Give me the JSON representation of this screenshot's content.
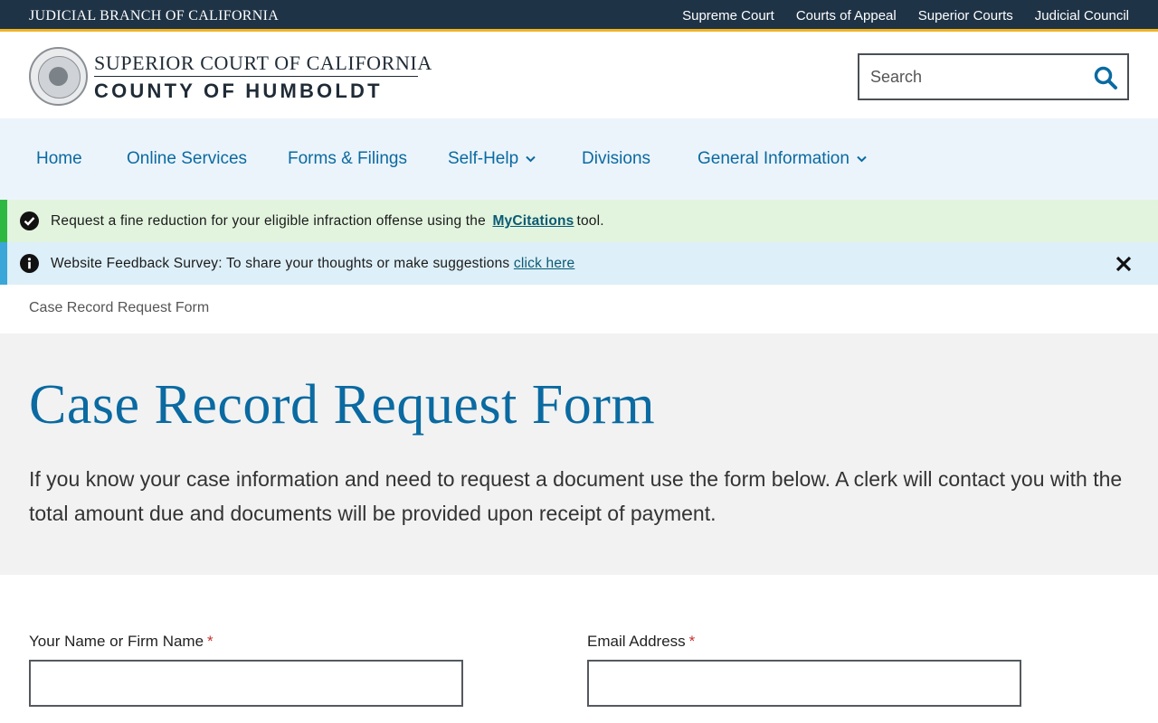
{
  "topbar": {
    "branch_label": "JUDICIAL BRANCH OF CALIFORNIA",
    "links": [
      "Supreme Court",
      "Courts of Appeal",
      "Superior Courts",
      "Judicial Council"
    ]
  },
  "header": {
    "brand_line1": "SUPERIOR COURT OF CALIFORNIA",
    "brand_line2": "COUNTY OF HUMBOLDT",
    "search_placeholder": "Search",
    "search_icon": "magnifier-icon"
  },
  "nav": {
    "items": [
      {
        "label": "Home",
        "has_dropdown": false
      },
      {
        "label": "Online Services",
        "has_dropdown": false
      },
      {
        "label": "Forms & Filings",
        "has_dropdown": false
      },
      {
        "label": "Self-Help",
        "has_dropdown": true
      },
      {
        "label": "Divisions",
        "has_dropdown": false
      },
      {
        "label": "General Information",
        "has_dropdown": true
      }
    ]
  },
  "alerts": {
    "mycitations": {
      "icon": "check-circle-icon",
      "text_before": "Request  a fine reduction for your eligible infraction offense using the ",
      "link_text": "MyCitations",
      "text_after": "tool."
    },
    "survey": {
      "icon": "info-circle-icon",
      "text_before": "Website Feedback Survey: To share your thoughts or make suggestions ",
      "link_text": "click here",
      "close_icon": "close-icon"
    }
  },
  "breadcrumb": {
    "current": "Case Record Request Form"
  },
  "hero": {
    "title": "Case Record Request Form",
    "intro": "If you know your case information and need to request a document use the form below.  A clerk will contact you with the total amount due and documents will be provided upon receipt of payment."
  },
  "form": {
    "name_label": "Your Name or Firm Name",
    "email_label": "Email Address",
    "required_marker": "*",
    "name_value": "",
    "email_value": ""
  },
  "colors": {
    "topbar_bg": "#1f3346",
    "topbar_accent": "#f0b323",
    "link_blue": "#0a6aa1",
    "nav_bg": "#ecf4fb",
    "alert_green": "#2fb841",
    "alert_blue": "#3ba6d8",
    "hero_bg": "#f2f2f2"
  }
}
